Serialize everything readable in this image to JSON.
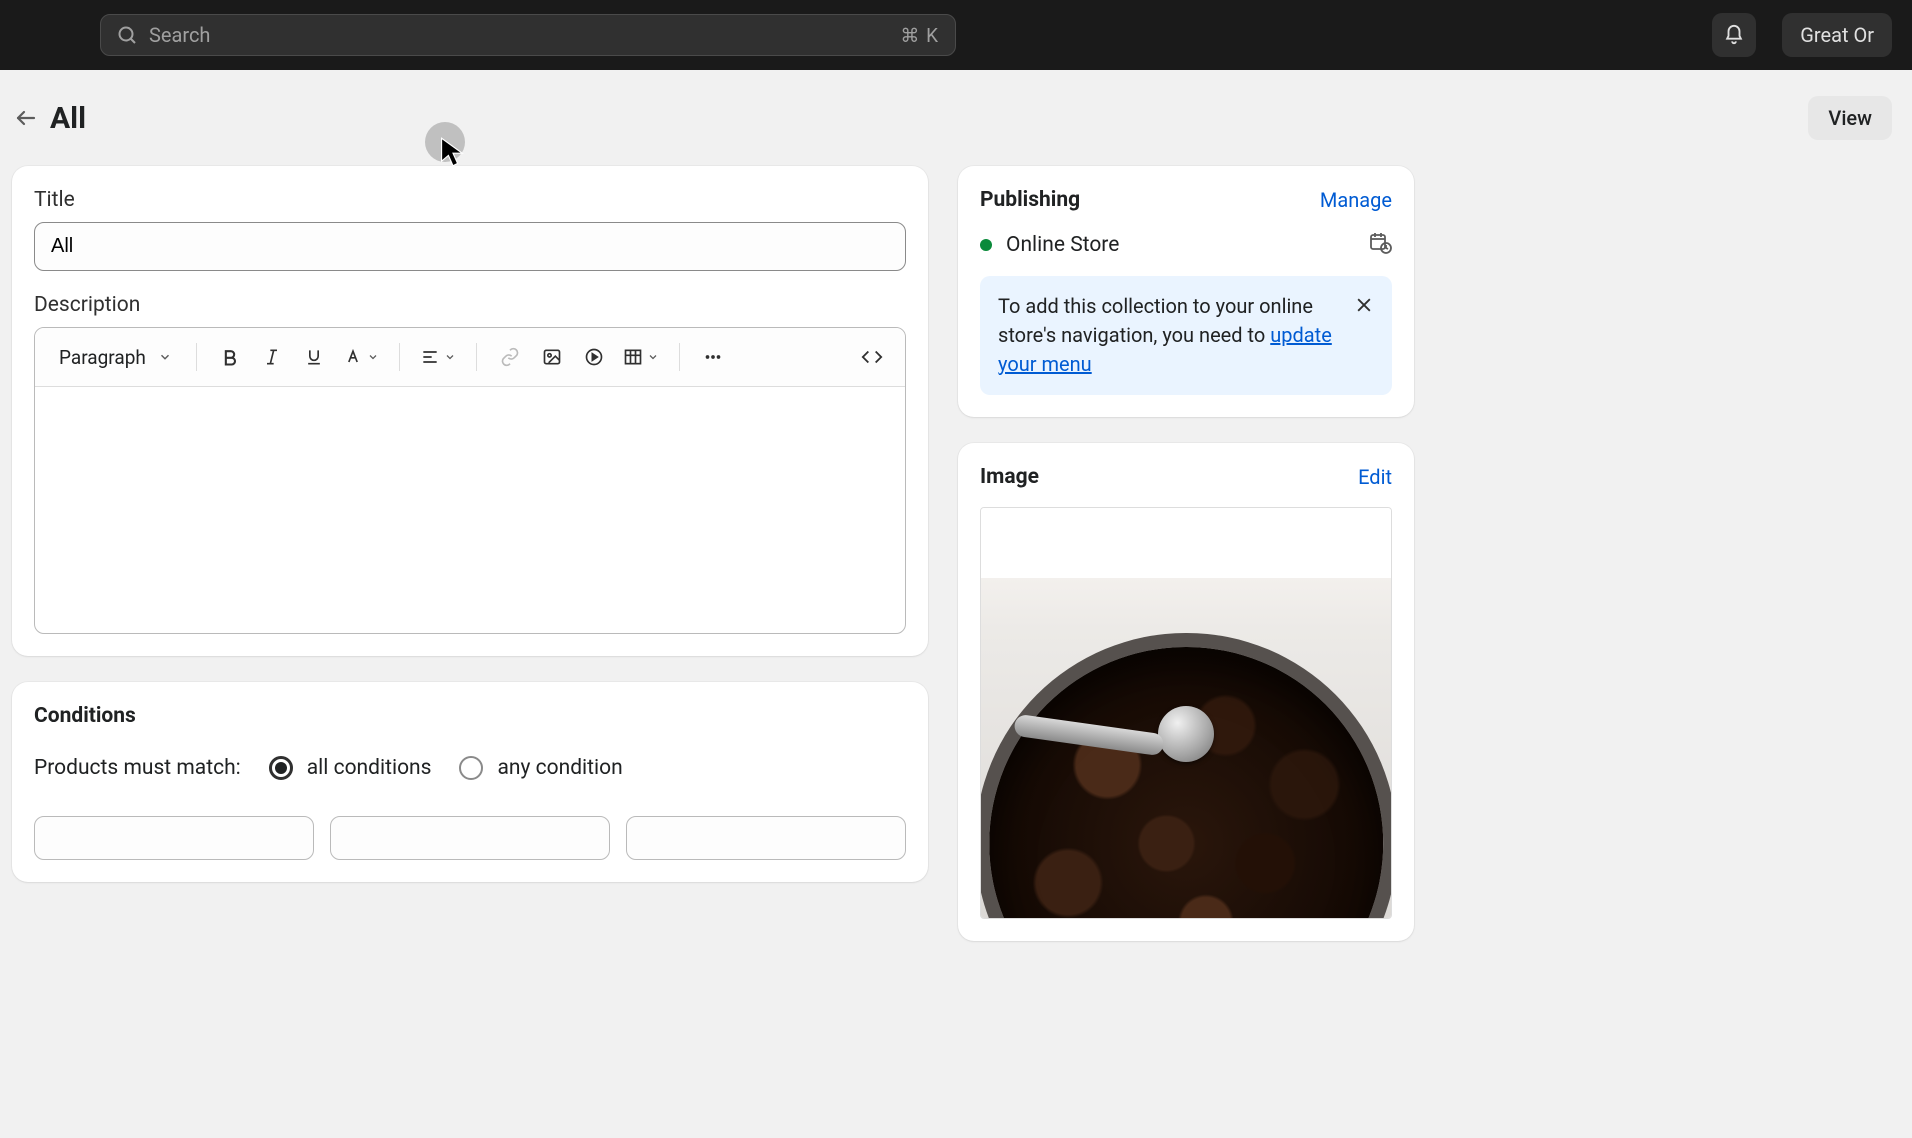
{
  "topbar": {
    "search_placeholder": "Search",
    "shortcut": "⌘ K",
    "account_label": "Great Or"
  },
  "header": {
    "title": "All",
    "view_label": "View"
  },
  "main": {
    "title_label": "Title",
    "title_value": "All",
    "description_label": "Description",
    "editor": {
      "paragraph_label": "Paragraph"
    }
  },
  "conditions": {
    "title": "Conditions",
    "match_label": "Products must match:",
    "all_label": "all conditions",
    "any_label": "any condition"
  },
  "publishing": {
    "title": "Publishing",
    "manage_label": "Manage",
    "channel_label": "Online Store",
    "banner_prefix": "To add this collection to your online store's navigation, you need to ",
    "banner_link": "update your menu"
  },
  "image_card": {
    "title": "Image",
    "edit_label": "Edit"
  }
}
